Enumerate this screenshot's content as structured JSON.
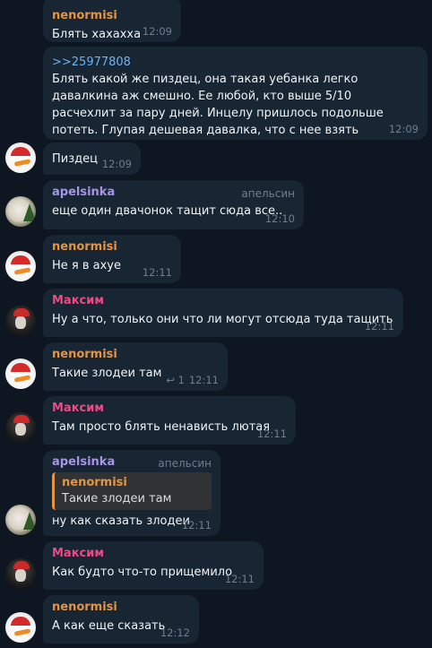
{
  "colors": {
    "background": "#0e1621",
    "bubble": "#182533",
    "name_nenormisi": "#e59542",
    "name_apelsinka": "#a695e7",
    "name_maksim": "#ee4a85",
    "link": "#6ab3f3",
    "meta": "#6d7f8f"
  },
  "messages": [
    {
      "sender": "nenormisi",
      "text": "Блять хахахха",
      "time": "12:09"
    },
    {
      "link": ">>25977808",
      "text": "Блять какой же пиздец, она такая уебанка легко давалкина аж смешно. Ее любой, кто выше 5/10 расчехлит за пару дней. Инцелу пришлось подольше потеть. Глупая дешевая давалка, что с нее взять",
      "time": "12:09"
    },
    {
      "text": "Пиздец",
      "time": "12:09",
      "avatar": "santa-icon"
    },
    {
      "sender": "apelsinka",
      "role": "апельсин",
      "text": "еще один двачонок тащит сюда все..",
      "time": "12:10",
      "avatar": "dog-icon"
    },
    {
      "sender": "nenormisi",
      "text": "Не я в ахуе",
      "time": "12:11",
      "avatar": "santa-icon"
    },
    {
      "sender": "Максим",
      "text": "Ну а что, только они что ли могут отсюда туда тащить",
      "time": "12:11",
      "avatar": "santa-hat-man-icon"
    },
    {
      "sender": "nenormisi",
      "text": "Такие злодеи там",
      "replies_count": "1",
      "time": "12:11",
      "avatar": "santa-icon"
    },
    {
      "sender": "Максим",
      "text": "Там просто блять ненависть лютая",
      "time": "12:11",
      "avatar": "santa-hat-man-icon"
    },
    {
      "sender": "apelsinka",
      "role": "апельсин",
      "quote": {
        "sender": "nenormisi",
        "text": "Такие злодеи там"
      },
      "text": "ну как сказать злодеи",
      "time": "12:11",
      "avatar": "dog-icon"
    },
    {
      "sender": "Максим",
      "text": "Как будто что-то прищемило",
      "time": "12:11",
      "avatar": "santa-hat-man-icon"
    },
    {
      "sender": "nenormisi",
      "text": "А как еще сказать",
      "time": "12:12",
      "avatar": "santa-icon"
    }
  ]
}
